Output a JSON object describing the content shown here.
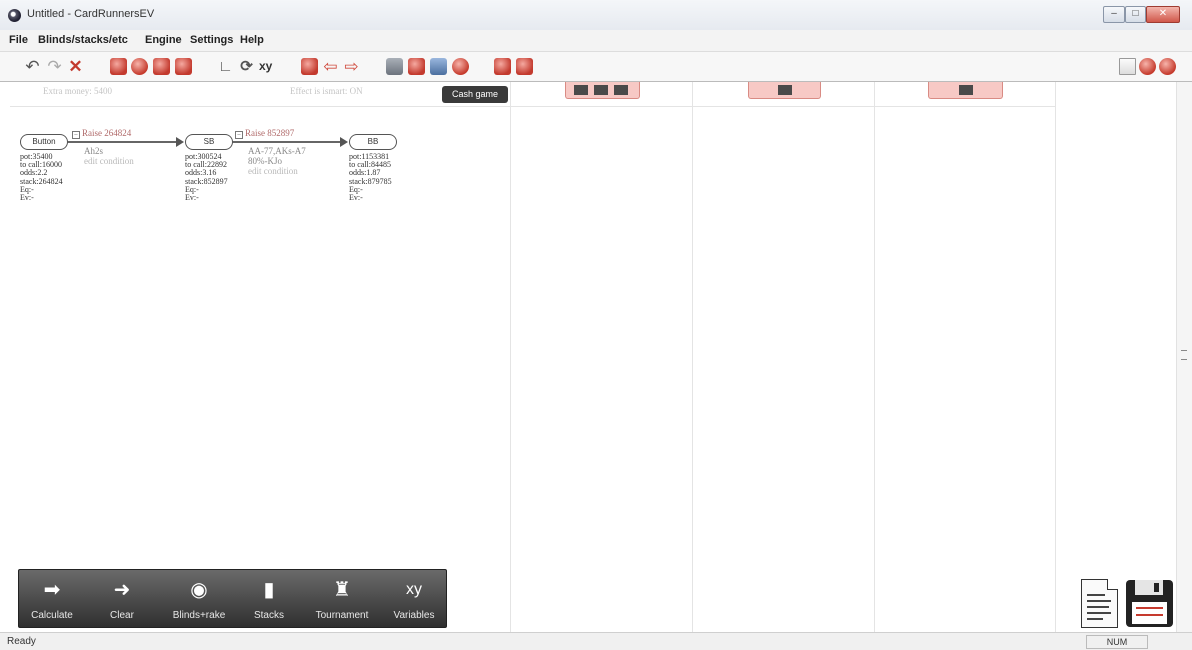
{
  "window": {
    "title": "Untitled - CardRunnersEV",
    "controls": {
      "minimize": "–",
      "maximize": "□",
      "close": "✕"
    }
  },
  "menu": [
    "File",
    "Blinds/stacks/etc",
    "Engine",
    "Settings",
    "Help"
  ],
  "toolbar": {
    "icons": [
      "undo-icon",
      "redo-icon",
      "delete-icon",
      "node-add-icon",
      "target-icon",
      "node-icon",
      "node-copy-icon",
      "chart-icon",
      "circle-icon",
      "xy-icon",
      "forward-icon",
      "left-arrow-icon",
      "right-arrow-icon",
      "stack-icon",
      "book-icon",
      "tree-icon",
      "settings-icon",
      "export-icon",
      "import-icon",
      "document-icon",
      "help-icon",
      "globe-icon"
    ],
    "tooltip": "Cash game"
  },
  "header_ghost": {
    "left": "Extra money: 5400",
    "right": "Effect is ismart: ON"
  },
  "tree": {
    "nodes": [
      {
        "label": "Button",
        "stats": [
          "pot:35400",
          "to call:16000",
          "odds:2.2",
          "stack:264824",
          "Eq:-",
          "Ev:-"
        ]
      },
      {
        "label": "SB",
        "stats": [
          "pot:300524",
          "to call:22892",
          "odds:3.16",
          "stack:852897",
          "Eq:-",
          "Ev:-"
        ]
      },
      {
        "label": "BB",
        "stats": [
          "pot:1153381",
          "to call:84485",
          "odds:1.87",
          "stack:879785",
          "Eq:-",
          "Ev:-"
        ]
      }
    ],
    "edges": [
      {
        "label": "Raise 264824",
        "range": "Ah2s",
        "condition": "edit condition"
      },
      {
        "label": "Raise 852897",
        "range": "AA-77,AKs-A7",
        "range2": "80%-KJo",
        "condition": "edit condition"
      }
    ]
  },
  "panel": [
    {
      "label": "Calculate",
      "icon": "calculate-icon"
    },
    {
      "label": "Clear",
      "icon": "clear-arrow-icon"
    },
    {
      "label": "Blinds+rake",
      "icon": "blinds-chip-icon"
    },
    {
      "label": "Stacks",
      "icon": "stacks-icon"
    },
    {
      "label": "Tournament",
      "icon": "tournament-icon"
    },
    {
      "label": "Variables",
      "icon": "variables-xy-icon"
    }
  ],
  "panel_glyphs": {
    "calculate": "➡",
    "clear": "➜",
    "blinds": "◉",
    "stacks": "▮",
    "tournament": "♜",
    "variables": "xy"
  },
  "status": {
    "text": "Ready",
    "num": "NUM"
  },
  "colors": {
    "accent_red": "#c33a2e",
    "category_fill": "#f7c9c5",
    "panel_dark": "#3a3a3a"
  }
}
